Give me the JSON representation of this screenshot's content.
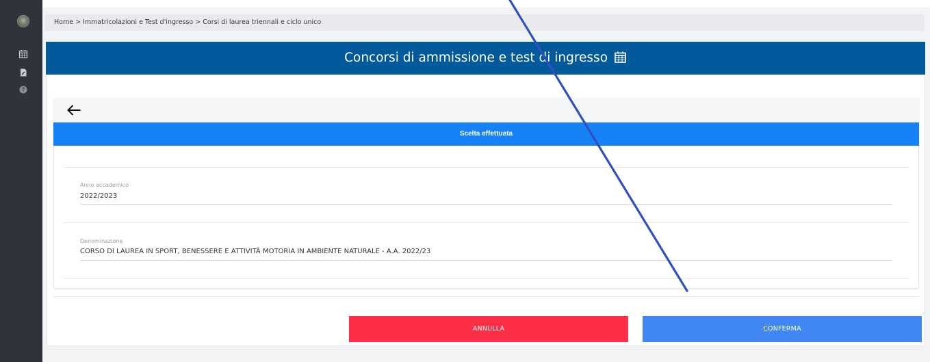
{
  "breadcrumb": {
    "text": "Home > Immatricolazioni e Test d'ingresso > Corsi di laurea triennali e ciclo unico"
  },
  "page": {
    "title": "Concorsi di ammissione e test di ingresso"
  },
  "section": {
    "title": "Scelta effettuata"
  },
  "fields": {
    "anno_label": "Anno accademico",
    "anno_value": "2022/2023",
    "denominazione_label": "Denominazione",
    "denominazione_value": "CORSO DI LAUREA IN SPORT, BENESSERE E ATTIVITÀ MOTORIA IN AMBIENTE NATURALE - A.A. 2022/23"
  },
  "actions": {
    "cancel_label": "ANNULLA",
    "confirm_label": "CONFERMA"
  },
  "sidebar": {
    "icons": [
      "logo-icon",
      "calendar-icon",
      "document-icon",
      "help-icon"
    ]
  },
  "colors": {
    "header": "#02599b",
    "section_bar": "#1682f5",
    "cancel": "#fc2f47",
    "confirm": "#4187f3",
    "sidebar": "#2e343a",
    "annotation_line": "#2e4fbf"
  }
}
